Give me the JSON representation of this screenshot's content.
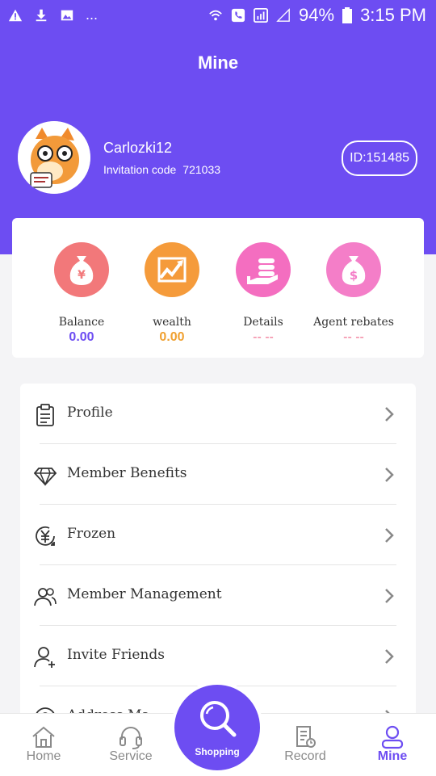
{
  "status_bar": {
    "dots": "...",
    "battery": "94%",
    "time": "3:15 PM"
  },
  "header": {
    "title": "Mine",
    "username": "Carlozki12",
    "invitation_label": "Invitation code",
    "invitation_code": "721033",
    "id_badge": "ID:151485"
  },
  "stats": [
    {
      "label": "Balance",
      "value": "0.00",
      "color": "#6d4df2",
      "icon": "money-bag-yen-icon"
    },
    {
      "label": "wealth",
      "value": "0.00",
      "color": "#f0a030",
      "icon": "growth-chart-icon"
    },
    {
      "label": "Details",
      "value": "-- --",
      "color": "#f07090",
      "icon": "coins-hand-icon"
    },
    {
      "label": "Agent rebates",
      "value": "-- --",
      "color": "#f07090",
      "icon": "money-bag-dollar-icon"
    }
  ],
  "menu": [
    {
      "label": "Profile",
      "icon": "clipboard-icon"
    },
    {
      "label": "Member Benefits",
      "icon": "diamond-icon"
    },
    {
      "label": "Frozen",
      "icon": "yen-refresh-icon"
    },
    {
      "label": "Member Management",
      "icon": "users-icon"
    },
    {
      "label": "Invite Friends",
      "icon": "add-user-icon"
    },
    {
      "label": "Address Ma",
      "icon": "location-icon"
    }
  ],
  "tabs": [
    {
      "label": "Home",
      "icon": "home-icon"
    },
    {
      "label": "Service",
      "icon": "headset-icon"
    },
    {
      "label": "Shopping",
      "icon": "search-icon"
    },
    {
      "label": "Record",
      "icon": "record-icon"
    },
    {
      "label": "Mine",
      "icon": "user-icon"
    }
  ],
  "colors": {
    "accent": "#6d4df2",
    "orange": "#f0a030",
    "pink": "#f07090"
  }
}
